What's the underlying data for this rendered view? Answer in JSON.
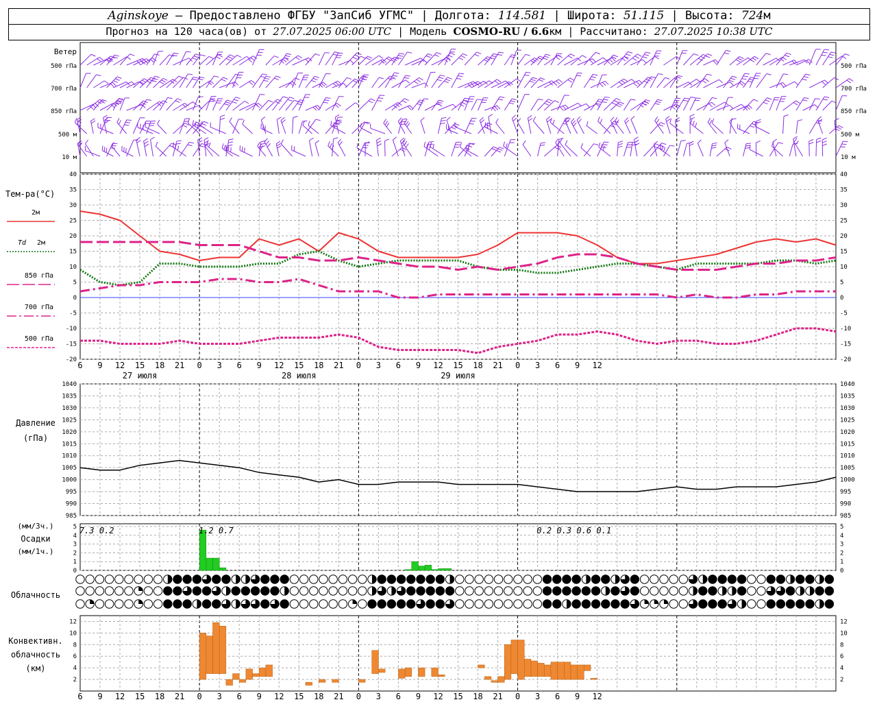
{
  "header": {
    "station": "Aginskoye",
    "provider": " – Предоставлено ФГБУ \"ЗапСиб УГМС\" | ",
    "lon_label": "Долгота: ",
    "lon": "114.581",
    "lat_label": " | Широта: ",
    "lat": "51.115",
    "alt_label": " | Высота: ",
    "alt": "724",
    "alt_unit": "м",
    "forecast_label": "Прогноз на 120 часа(ов) от ",
    "forecast_time": "27.07.2025 06:00 UTC",
    "model_label": " | Модель ",
    "model": "COSMO-RU / 6.6",
    "model_unit": "км",
    "calc_label": " | Рассчитано: ",
    "calc_time": "27.07.2025 10:38 UTC"
  },
  "wind_panel": {
    "title": "Ветер",
    "levels": [
      "500 гПа",
      "700 гПа",
      "850 гПа",
      "500 м",
      "10  м"
    ],
    "color": "#8a2be2"
  },
  "temp_panel": {
    "title": "Тем-ра(°C)",
    "legend": [
      {
        "label": "2м",
        "color": "#ee3333",
        "style": "solid"
      },
      {
        "label": "Td  2м",
        "color": "#117711",
        "style": "dotted"
      },
      {
        "label": "850 гПа",
        "color": "#dd2288",
        "style": "longdash"
      },
      {
        "label": "700 гПа",
        "color": "#dd2288",
        "style": "dashdot"
      },
      {
        "label": "500 гПа",
        "color": "#dd2288",
        "style": "dense-dash"
      }
    ],
    "y_ticks": [
      "40",
      "35",
      "30",
      "25",
      "20",
      "15",
      "10",
      "5",
      "0",
      "-5",
      "-10",
      "-15",
      "-20"
    ]
  },
  "x_axis": {
    "hour_labels": [
      "6",
      "9",
      "12",
      "15",
      "18",
      "21",
      "0",
      "3",
      "6",
      "9",
      "12",
      "15",
      "18",
      "21",
      "0",
      "3",
      "6",
      "9",
      "12",
      "15",
      "18",
      "21",
      "0",
      "3",
      "6",
      "9",
      "12"
    ],
    "day_labels": [
      "27 июля",
      "28 июля",
      "29 июля"
    ]
  },
  "pressure_panel": {
    "title_1": "Давление",
    "title_2": "(гПа)",
    "y_ticks": [
      "1040",
      "1035",
      "1030",
      "1025",
      "1020",
      "1015",
      "1010",
      "1005",
      "1000",
      "995",
      "990",
      "985"
    ]
  },
  "precip_panel": {
    "title_1": "(мм/3ч.)",
    "title_2": "Осадки",
    "title_3": "(мм/1ч.)",
    "y_ticks": [
      "5",
      "4",
      "3",
      "2",
      "1",
      "0"
    ],
    "totals": [
      {
        "hour": 1,
        "text": "7.3"
      },
      {
        "hour": 4,
        "text": "0.2"
      },
      {
        "hour": 19,
        "text": "1.2"
      },
      {
        "hour": 22,
        "text": "0.7"
      },
      {
        "hour": 70,
        "text": "0.2"
      },
      {
        "hour": 73,
        "text": "0.3"
      },
      {
        "hour": 76,
        "text": "0.6"
      },
      {
        "hour": 79,
        "text": "0.1"
      }
    ]
  },
  "cloud_panel": {
    "title": "Облачность"
  },
  "conv_panel": {
    "title_1": "Конвективн.",
    "title_2": "облачность",
    "title_3": "(км)",
    "y_ticks": [
      "12",
      "10",
      "8",
      "6",
      "4",
      "2"
    ]
  },
  "chart_data": [
    {
      "type": "line",
      "title": "Тем-ра(°C)",
      "x_unit": "hours from 27.07.2025 06:00 UTC",
      "ylim": [
        -20,
        40
      ],
      "series": [
        {
          "name": "2м",
          "x": [
            0,
            3,
            6,
            9,
            12,
            15,
            18,
            21,
            24,
            27,
            30,
            33,
            36,
            39,
            42,
            45,
            48,
            51,
            54,
            57,
            60,
            63,
            66,
            69,
            72,
            75,
            78,
            81,
            84,
            87,
            90,
            93,
            96,
            99,
            102,
            105,
            108,
            111,
            114
          ],
          "values": [
            28,
            27,
            25,
            20,
            15,
            14,
            12,
            13,
            13,
            19,
            17,
            19,
            15,
            21,
            19,
            15,
            13,
            13,
            13,
            13,
            14,
            17,
            21,
            21,
            21,
            20,
            17,
            13,
            11,
            11,
            12,
            13,
            14,
            16,
            18,
            19,
            18,
            19,
            17
          ]
        },
        {
          "name": "Td 2м",
          "x": [
            0,
            3,
            6,
            9,
            12,
            15,
            18,
            21,
            24,
            27,
            30,
            33,
            36,
            39,
            42,
            45,
            48,
            51,
            54,
            57,
            60,
            63,
            66,
            69,
            72,
            75,
            78,
            81,
            84,
            87,
            90,
            93,
            96,
            99,
            102,
            105,
            108,
            111,
            114
          ],
          "values": [
            9,
            5,
            4,
            5,
            11,
            11,
            10,
            10,
            10,
            11,
            11,
            14,
            15,
            12,
            10,
            11,
            12,
            12,
            12,
            12,
            10,
            9,
            9,
            8,
            8,
            9,
            10,
            11,
            11,
            10,
            9,
            11,
            11,
            11,
            11,
            12,
            12,
            11,
            12
          ]
        },
        {
          "name": "850 гПа",
          "x": [
            0,
            3,
            6,
            9,
            12,
            15,
            18,
            21,
            24,
            27,
            30,
            33,
            36,
            39,
            42,
            45,
            48,
            51,
            54,
            57,
            60,
            63,
            66,
            69,
            72,
            75,
            78,
            81,
            84,
            87,
            90,
            93,
            96,
            99,
            102,
            105,
            108,
            111,
            114
          ],
          "values": [
            18,
            18,
            18,
            18,
            18,
            18,
            17,
            17,
            17,
            15,
            13,
            13,
            12,
            12,
            13,
            12,
            11,
            10,
            10,
            9,
            10,
            9,
            10,
            11,
            13,
            14,
            14,
            13,
            11,
            10,
            9,
            9,
            9,
            10,
            11,
            11,
            12,
            12,
            13
          ]
        },
        {
          "name": "700 гПа",
          "x": [
            0,
            3,
            6,
            9,
            12,
            15,
            18,
            21,
            24,
            27,
            30,
            33,
            36,
            39,
            42,
            45,
            48,
            51,
            54,
            57,
            60,
            63,
            66,
            69,
            72,
            75,
            78,
            81,
            84,
            87,
            90,
            93,
            96,
            99,
            102,
            105,
            108,
            111,
            114
          ],
          "values": [
            2,
            3,
            4,
            4,
            5,
            5,
            5,
            6,
            6,
            5,
            5,
            6,
            4,
            2,
            2,
            2,
            0,
            0,
            1,
            1,
            1,
            1,
            1,
            1,
            1,
            1,
            1,
            1,
            1,
            1,
            0,
            1,
            0,
            0,
            1,
            1,
            2,
            2,
            2
          ]
        },
        {
          "name": "500 гПа",
          "x": [
            0,
            3,
            6,
            9,
            12,
            15,
            18,
            21,
            24,
            27,
            30,
            33,
            36,
            39,
            42,
            45,
            48,
            51,
            54,
            57,
            60,
            63,
            66,
            69,
            72,
            75,
            78,
            81,
            84,
            87,
            90,
            93,
            96,
            99,
            102,
            105,
            108,
            111,
            114
          ],
          "values": [
            -14,
            -14,
            -15,
            -15,
            -15,
            -14,
            -15,
            -15,
            -15,
            -14,
            -13,
            -13,
            -13,
            -12,
            -13,
            -16,
            -17,
            -17,
            -17,
            -17,
            -18,
            -16,
            -15,
            -14,
            -12,
            -12,
            -11,
            -12,
            -14,
            -15,
            -14,
            -14,
            -15,
            -15,
            -14,
            -12,
            -10,
            -10,
            -11
          ]
        }
      ]
    },
    {
      "type": "line",
      "title": "Давление (гПа)",
      "x_unit": "hours from 27.07.2025 06:00 UTC",
      "ylim": [
        985,
        1040
      ],
      "series": [
        {
          "name": "",
          "x": [
            0,
            3,
            6,
            9,
            12,
            15,
            18,
            21,
            24,
            27,
            30,
            33,
            36,
            39,
            42,
            45,
            48,
            51,
            54,
            57,
            60,
            63,
            66,
            69,
            72,
            75,
            78,
            81,
            84,
            87,
            90,
            93,
            96,
            99,
            102,
            105,
            108,
            111,
            114
          ],
          "values": [
            1005,
            1004,
            1004,
            1006,
            1007,
            1008,
            1007,
            1006,
            1005,
            1003,
            1002,
            1001,
            999,
            1000,
            998,
            998,
            999,
            999,
            999,
            998,
            998,
            998,
            998,
            997,
            996,
            995,
            995,
            995,
            995,
            996,
            997,
            996,
            996,
            997,
            997,
            997,
            998,
            999,
            1001
          ]
        }
      ]
    },
    {
      "type": "bar",
      "title": "Осадки (мм/1ч.)",
      "x_unit": "hours from 27.07.2025 06:00 UTC",
      "ylim": [
        0,
        5
      ],
      "x": [
        18,
        19,
        20,
        21,
        22,
        23,
        24,
        25,
        26,
        27,
        28,
        49,
        50,
        51,
        52,
        53,
        54,
        55,
        56,
        57,
        58,
        59,
        60,
        61,
        62,
        63,
        64,
        65,
        66,
        67,
        68,
        69
      ],
      "values": [
        4.6,
        1.4,
        1.4,
        0.3,
        0,
        0,
        0,
        0,
        0,
        0,
        0,
        0.1,
        1.0,
        0.5,
        0.6,
        0.1,
        0.2,
        0.2,
        0,
        0,
        0,
        0,
        0,
        0,
        0,
        0,
        0,
        0,
        0,
        0,
        0,
        0
      ]
    },
    {
      "type": "bar",
      "title": "Конвективн. облачность (км)",
      "x_unit": "hours from 27.07.2025 06:00 UTC",
      "ylim": [
        0,
        13
      ],
      "bars": [
        {
          "x": 18,
          "base": 2,
          "top": 10
        },
        {
          "x": 19,
          "base": 3,
          "top": 9.5
        },
        {
          "x": 20,
          "base": 3,
          "top": 11.8
        },
        {
          "x": 21,
          "base": 3,
          "top": 11.2
        },
        {
          "x": 22,
          "base": 1,
          "top": 2
        },
        {
          "x": 23,
          "base": 2,
          "top": 3
        },
        {
          "x": 24,
          "base": 1.5,
          "top": 2
        },
        {
          "x": 25,
          "base": 2,
          "top": 3.8
        },
        {
          "x": 26,
          "base": 2.5,
          "top": 3
        },
        {
          "x": 27,
          "base": 2.5,
          "top": 4
        },
        {
          "x": 28,
          "base": 2.5,
          "top": 4.5
        },
        {
          "x": 34,
          "base": 1,
          "top": 1.5
        },
        {
          "x": 36,
          "base": 1.5,
          "top": 2
        },
        {
          "x": 38,
          "base": 1.5,
          "top": 2
        },
        {
          "x": 42,
          "base": 1.5,
          "top": 2
        },
        {
          "x": 44,
          "base": 3,
          "top": 7
        },
        {
          "x": 45,
          "base": 3.2,
          "top": 3.8
        },
        {
          "x": 48,
          "base": 2.2,
          "top": 3.8
        },
        {
          "x": 49,
          "base": 2.5,
          "top": 4
        },
        {
          "x": 51,
          "base": 2.5,
          "top": 4
        },
        {
          "x": 53,
          "base": 2.5,
          "top": 4
        },
        {
          "x": 54,
          "base": 2.5,
          "top": 2.8
        },
        {
          "x": 60,
          "base": 4,
          "top": 4.5
        },
        {
          "x": 61,
          "base": 2,
          "top": 2.5
        },
        {
          "x": 62,
          "base": 1.5,
          "top": 1.8
        },
        {
          "x": 63,
          "base": 1.5,
          "top": 2.5
        },
        {
          "x": 64,
          "base": 2,
          "top": 8
        },
        {
          "x": 65,
          "base": 3,
          "top": 8.8
        },
        {
          "x": 66,
          "base": 2,
          "top": 8.8
        },
        {
          "x": 67,
          "base": 2.5,
          "top": 5.5
        },
        {
          "x": 68,
          "base": 2.5,
          "top": 5.2
        },
        {
          "x": 69,
          "base": 2.5,
          "top": 4.8
        },
        {
          "x": 70,
          "base": 2.5,
          "top": 4.5
        },
        {
          "x": 71,
          "base": 2,
          "top": 5
        },
        {
          "x": 72,
          "base": 2,
          "top": 5
        },
        {
          "x": 73,
          "base": 2,
          "top": 5
        },
        {
          "x": 74,
          "base": 2,
          "top": 4.5
        },
        {
          "x": 75,
          "base": 2,
          "top": 4.5
        },
        {
          "x": 76,
          "base": 3.5,
          "top": 4.5
        },
        {
          "x": 77,
          "base": 2,
          "top": 2.2
        }
      ]
    }
  ]
}
